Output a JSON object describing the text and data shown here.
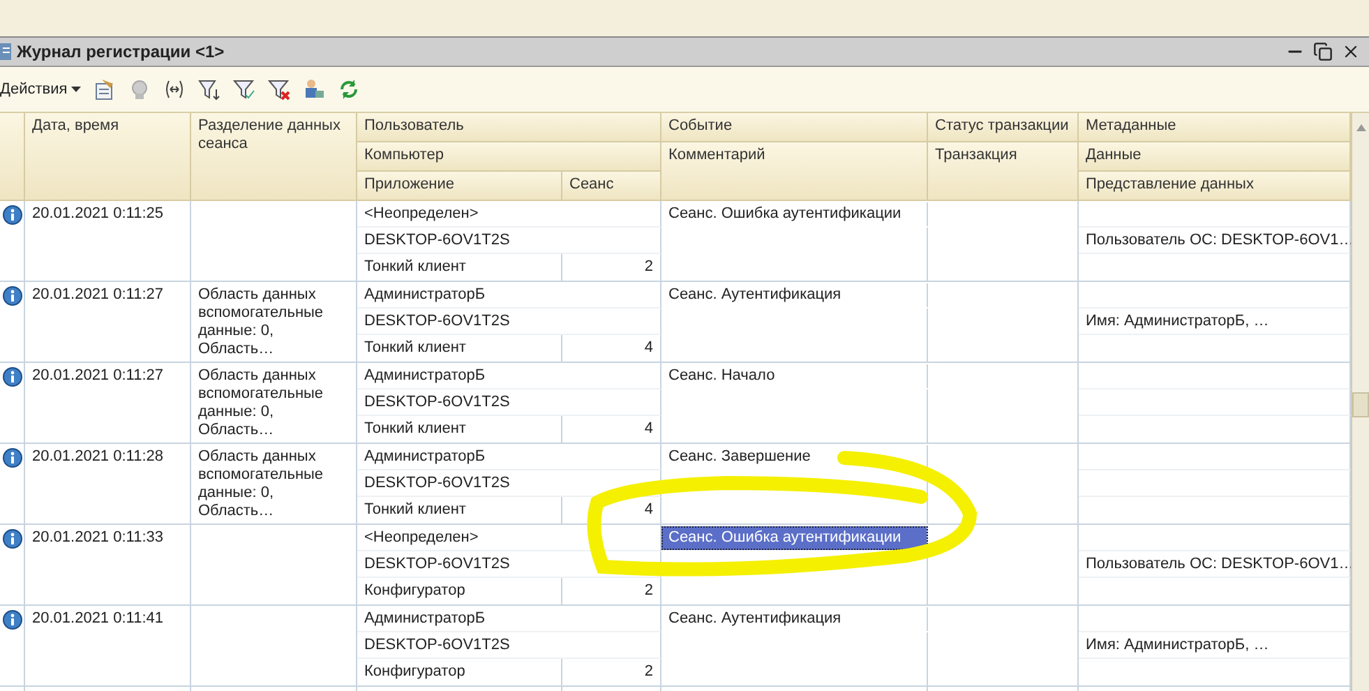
{
  "window": {
    "title": "Журнал регистрации <1>"
  },
  "toolbar": {
    "actions_label": "Действия"
  },
  "header": {
    "date": "Дата, время",
    "separation": "Разделение данных сеанса",
    "user": "Пользователь",
    "computer": "Компьютер",
    "application": "Приложение",
    "session": "Сеанс",
    "event": "Событие",
    "comment": "Комментарий",
    "status": "Статус транзакции",
    "transaction": "Транзакция",
    "metadata": "Метаданные",
    "data": "Данные",
    "presentation": "Представление данных"
  },
  "rows": [
    {
      "date": "20.01.2021 0:11:25",
      "separation": "",
      "user": "<Неопределен>",
      "computer": "DESKTOP-6OV1T2S",
      "application": "Тонкий клиент",
      "session": "2",
      "event": "Сеанс. Ошибка аутентификации",
      "data": "Пользователь ОС: DESKTOP-6OV1…",
      "selected": false
    },
    {
      "date": "20.01.2021 0:11:27",
      "separation": "Область данных вспомогательные данные: 0, Область…",
      "user": "АдминистраторБ",
      "computer": "DESKTOP-6OV1T2S",
      "application": "Тонкий клиент",
      "session": "4",
      "event": "Сеанс. Аутентификация",
      "data": "Имя: АдминистраторБ, …",
      "selected": false
    },
    {
      "date": "20.01.2021 0:11:27",
      "separation": "Область данных вспомогательные данные: 0, Область…",
      "user": "АдминистраторБ",
      "computer": "DESKTOP-6OV1T2S",
      "application": "Тонкий клиент",
      "session": "4",
      "event": "Сеанс. Начало",
      "data": "",
      "selected": false
    },
    {
      "date": "20.01.2021 0:11:28",
      "separation": "Область данных вспомогательные данные: 0, Область…",
      "user": "АдминистраторБ",
      "computer": "DESKTOP-6OV1T2S",
      "application": "Тонкий клиент",
      "session": "4",
      "event": "Сеанс. Завершение",
      "data": "",
      "selected": false
    },
    {
      "date": "20.01.2021 0:11:33",
      "separation": "",
      "user": "<Неопределен>",
      "computer": "DESKTOP-6OV1T2S",
      "application": "Конфигуратор",
      "session": "2",
      "event": "Сеанс. Ошибка аутентификации",
      "data": "Пользователь ОС: DESKTOP-6OV1…",
      "selected": true
    },
    {
      "date": "20.01.2021 0:11:41",
      "separation": "",
      "user": "АдминистраторБ",
      "computer": "DESKTOP-6OV1T2S",
      "application": "Конфигуратор",
      "session": "2",
      "event": "Сеанс. Аутентификация",
      "data": "Имя: АдминистраторБ, …",
      "selected": false
    }
  ]
}
